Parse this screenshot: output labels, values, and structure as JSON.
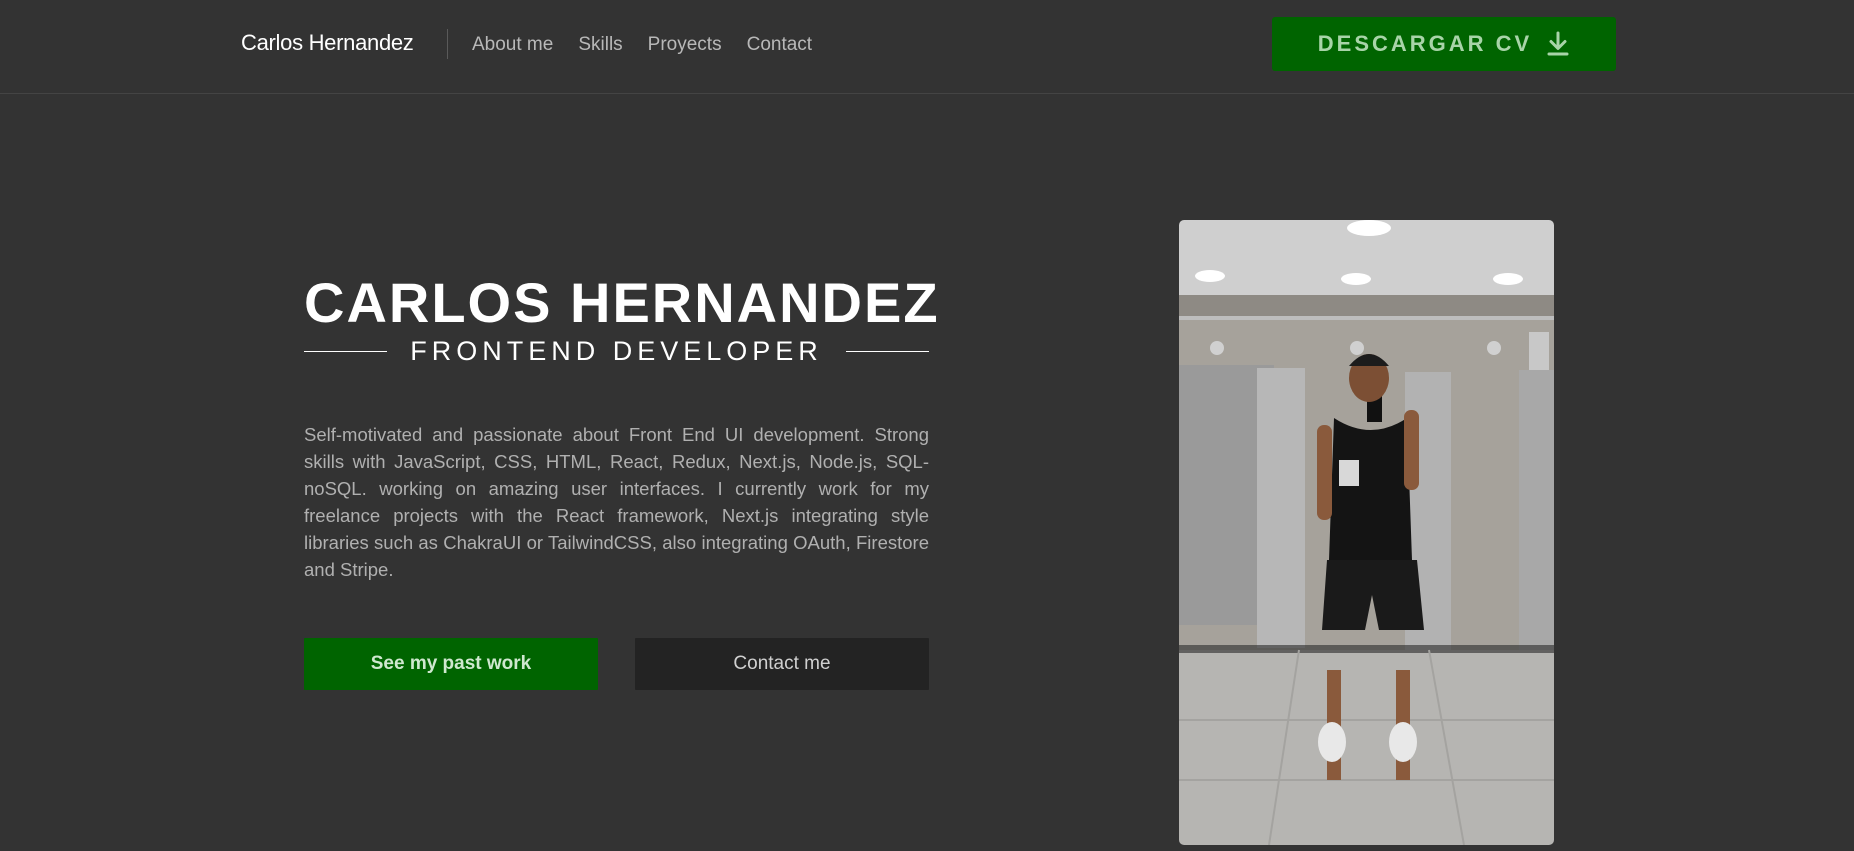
{
  "header": {
    "brand": "Carlos Hernandez",
    "nav": [
      {
        "label": "About me"
      },
      {
        "label": "Skills"
      },
      {
        "label": "Proyects"
      },
      {
        "label": "Contact"
      }
    ],
    "cv_button": {
      "label": "DESCARGAR CV",
      "icon": "download-icon"
    }
  },
  "hero": {
    "name": "CARLOS HERNANDEZ",
    "role": "FRONTEND DEVELOPER",
    "description": "Self-motivated and passionate about Front End UI development. Strong skills with JavaScript, CSS, HTML, React, Redux, Next.js, Node.js, SQL-noSQL. working on amazing user interfaces. I currently work for my freelance projects with the React framework, Next.js integrating style libraries such as ChakraUI or TailwindCSS, also integrating OAuth, Firestore and Stripe.",
    "buttons": {
      "work": "See my past work",
      "contact": "Contact me"
    }
  },
  "photo": {
    "subject": "profile-photo"
  },
  "colors": {
    "background": "#333333",
    "accent_green": "#006400",
    "dark_button": "#232323",
    "nav_text": "#b8b8b8",
    "body_text": "#b0b0b0"
  }
}
